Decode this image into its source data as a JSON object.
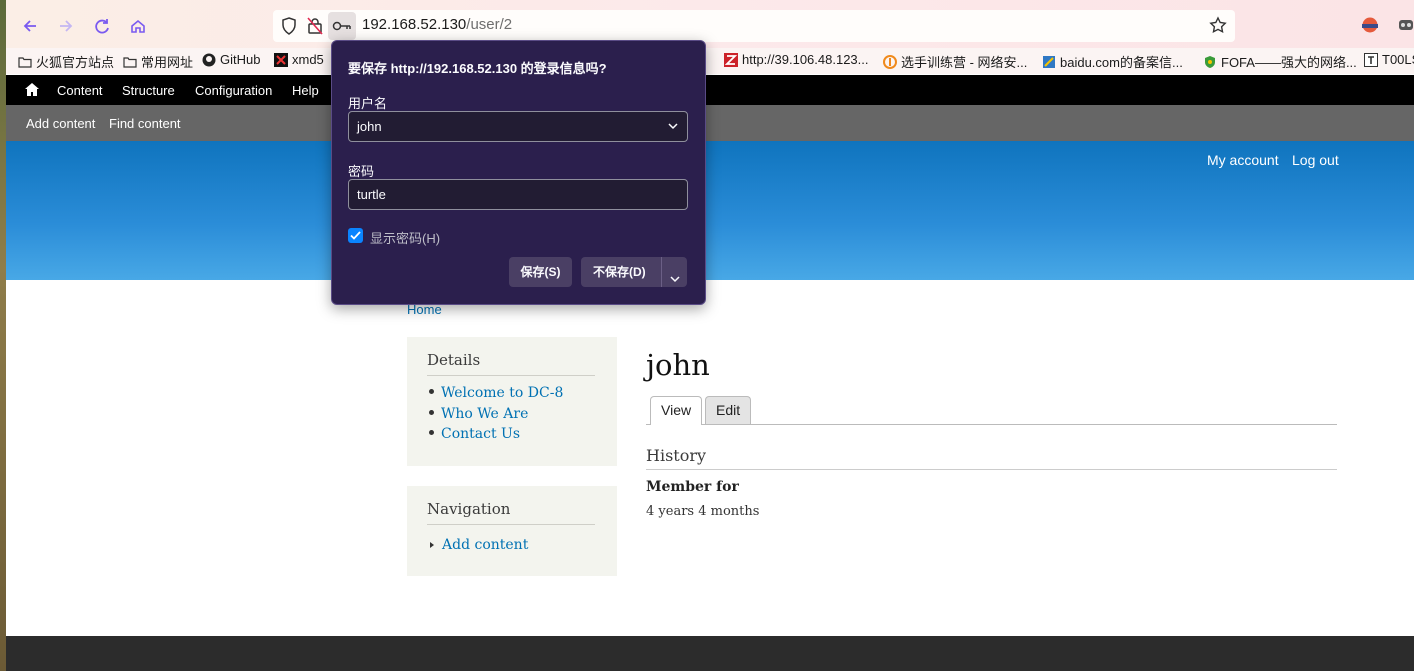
{
  "browser": {
    "url_host": "192.168.52.130",
    "url_path": "/user/2",
    "bookmarks": [
      {
        "label": "火狐官方站点",
        "icon": "folder-icon"
      },
      {
        "label": "常用网址",
        "icon": "folder-icon"
      },
      {
        "label": "GitHub",
        "icon": "github-icon"
      },
      {
        "label": "xmd5",
        "icon": "xmd5-icon"
      },
      {
        "label": "http://39.106.48.123...",
        "icon": "zotero-icon"
      },
      {
        "label": "选手训练营 - 网络安...",
        "icon": "flame-icon"
      },
      {
        "label": "baidu.com的备案信...",
        "icon": "doc-icon"
      },
      {
        "label": "FOFA——强大的网络...",
        "icon": "shield-icon"
      },
      {
        "label": "T00LS",
        "icon": "tools-icon"
      }
    ]
  },
  "password_prompt": {
    "question": "要保存 http://192.168.52.130 的登录信息吗?",
    "username_label": "用户名",
    "username_value": "john",
    "password_label": "密码",
    "password_value": "turtle",
    "show_password_label": "显示密码(H)",
    "show_password_checked": true,
    "save_label": "保存(S)",
    "dont_save_label": "不保存(D)"
  },
  "admin_toolbar": {
    "items": [
      "Content",
      "Structure",
      "Configuration",
      "Help"
    ],
    "shortcuts": [
      "Add content",
      "Find content"
    ]
  },
  "header_links": [
    "My account",
    "Log out"
  ],
  "breadcrumb": "Home",
  "sidebar": {
    "details": {
      "title": "Details",
      "links": [
        "Welcome to DC-8",
        "Who We Are",
        "Contact Us"
      ]
    },
    "navigation": {
      "title": "Navigation",
      "links": [
        "Add content"
      ]
    }
  },
  "content": {
    "title": "john",
    "tabs": [
      "View",
      "Edit"
    ],
    "history_heading": "History",
    "member_for_label": "Member for",
    "member_for_value": "4 years 4 months"
  },
  "colors": {
    "popup_bg": "#2b1f4d",
    "link": "#0071b3",
    "header_blue": "#1c82cc"
  }
}
